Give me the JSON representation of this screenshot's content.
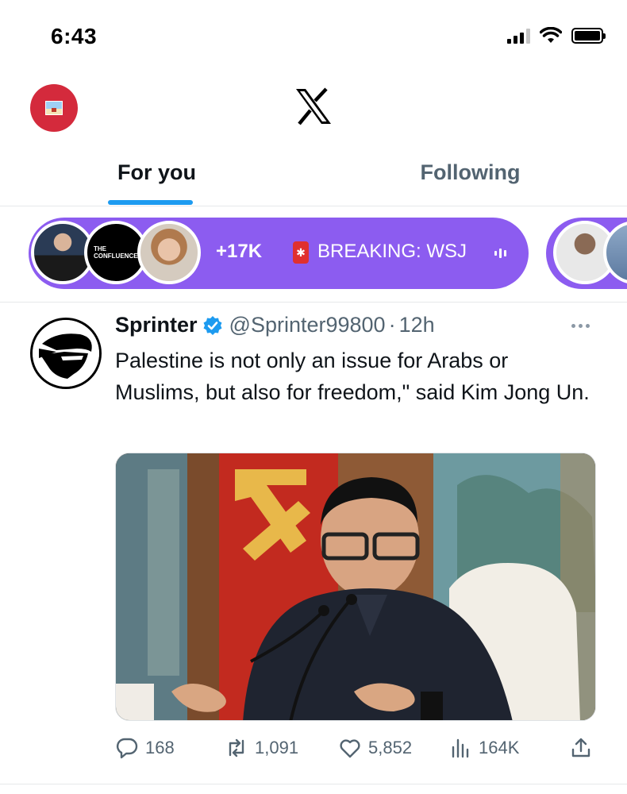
{
  "status_bar": {
    "time": "6:43"
  },
  "header": {
    "logo": "x-logo-icon",
    "profile_avatar": "avatar"
  },
  "tabs": [
    {
      "label": "For you",
      "active": true
    },
    {
      "label": "Following",
      "active": false
    }
  ],
  "spaces": {
    "live_space": {
      "listener_count": "+17K",
      "title": "BREAKING: WSJ",
      "avatar_text": "THE CONFLUENCE"
    }
  },
  "tweet": {
    "display_name": "Sprinter",
    "verified": true,
    "handle": "@Sprinter99800",
    "separator": "·",
    "time": "12h",
    "text": "Palestine is not only an issue for Arabs or Muslims, but also for freedom,\" said Kim Jong Un.",
    "metrics": {
      "replies": "168",
      "reposts": "1,091",
      "likes": "5,852",
      "views": "164K"
    }
  },
  "colors": {
    "accent": "#1d9bf0",
    "spaces_purple": "#8c5cf0",
    "secondary_text": "#536471",
    "primary_text": "#0f1419"
  }
}
